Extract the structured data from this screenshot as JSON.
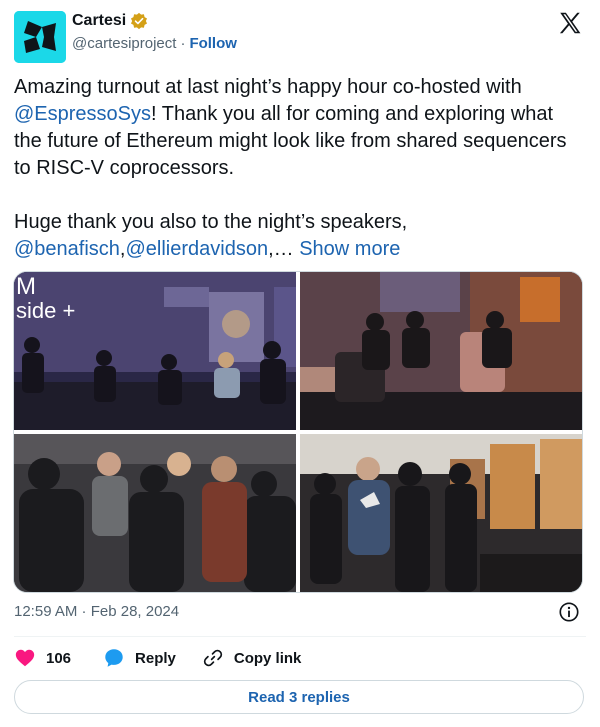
{
  "author": {
    "name": "Cartesi",
    "handle": "@cartesiproject",
    "separator": "·",
    "follow_label": "Follow",
    "verified_color": "#d4a017",
    "avatar_color": "#1bd8e8"
  },
  "tweet": {
    "part1_before": "Amazing turnout at last night’s happy hour co-hosted with ",
    "mention1": "@EspressoSys",
    "part1_after": "! Thank you all for coming and exploring what the future of Ethereum might look like from shared sequencers to RISC-V coprocessors.",
    "part2_before": "Huge thank you also to the night’s speakers, ",
    "mention2": "@benafisch",
    "comma": ",",
    "mention3": "@ellierdavidson",
    "ellipsis": ",… ",
    "show_more": "Show more"
  },
  "photos": {
    "p1_overlay_text": "side +",
    "p1_overlay_letters": "M"
  },
  "meta": {
    "timestamp": "12:59 AM · Feb 28, 2024"
  },
  "actions": {
    "likes": "106",
    "reply": "Reply",
    "copy_link": "Copy link"
  },
  "read_replies": "Read 3 replies",
  "icons": {
    "x": "x-logo-icon",
    "verified": "verified-badge-icon",
    "info": "info-icon",
    "heart": "heart-icon",
    "reply": "reply-bubble-icon",
    "link": "link-icon"
  },
  "colors": {
    "link": "#1d64b0",
    "like": "#f91880",
    "text": "#0f1419",
    "muted": "#536471"
  }
}
